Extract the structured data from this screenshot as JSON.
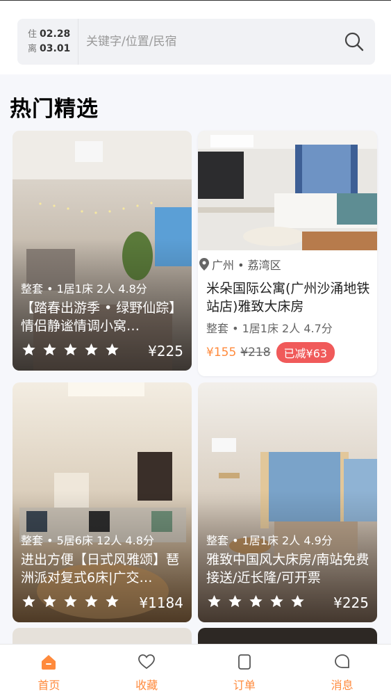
{
  "search": {
    "checkin_label": "住",
    "checkin_date": "02.28",
    "checkout_label": "离",
    "checkout_date": "03.01",
    "placeholder": "关键字/位置/民宿",
    "icon": "search-icon"
  },
  "section_title": "热门精选",
  "listings": [
    {
      "meta": "整套 • 1居1床 2人 4.8分",
      "title": "【踏春出游季 • 绿野仙踪】情侣静谧情调小窝…",
      "rating_stars": 5,
      "price": "¥225"
    },
    {
      "location": "广州 • 荔湾区",
      "title": "米朵国际公寓(广州沙涌地铁站店)雅致大床房",
      "meta": "整套 • 1居1床 2人 4.7分",
      "price": "¥155",
      "original_price": "¥218",
      "discount": "已减¥63"
    },
    {
      "meta": "整套 • 5居6床 12人 4.8分",
      "title": "进出方便【日式风雅颂】琶洲派对复式6床|广交…",
      "rating_stars": 5,
      "price": "¥1184"
    },
    {
      "meta": "整套 • 1居1床 2人 4.9分",
      "title": "雅致中国风大床房/南站免费接送/近长隆/可开票",
      "rating_stars": 5,
      "price": "¥225"
    }
  ],
  "tabs": [
    {
      "label": "首页",
      "icon": "home-icon",
      "active": true
    },
    {
      "label": "收藏",
      "icon": "heart-icon",
      "active": false
    },
    {
      "label": "订单",
      "icon": "order-icon",
      "active": false
    },
    {
      "label": "消息",
      "icon": "message-icon",
      "active": false
    }
  ],
  "colors": {
    "accent": "#ff8a3c",
    "discount_bg": "#f05a5a",
    "page_bg": "#f6f7fb"
  }
}
